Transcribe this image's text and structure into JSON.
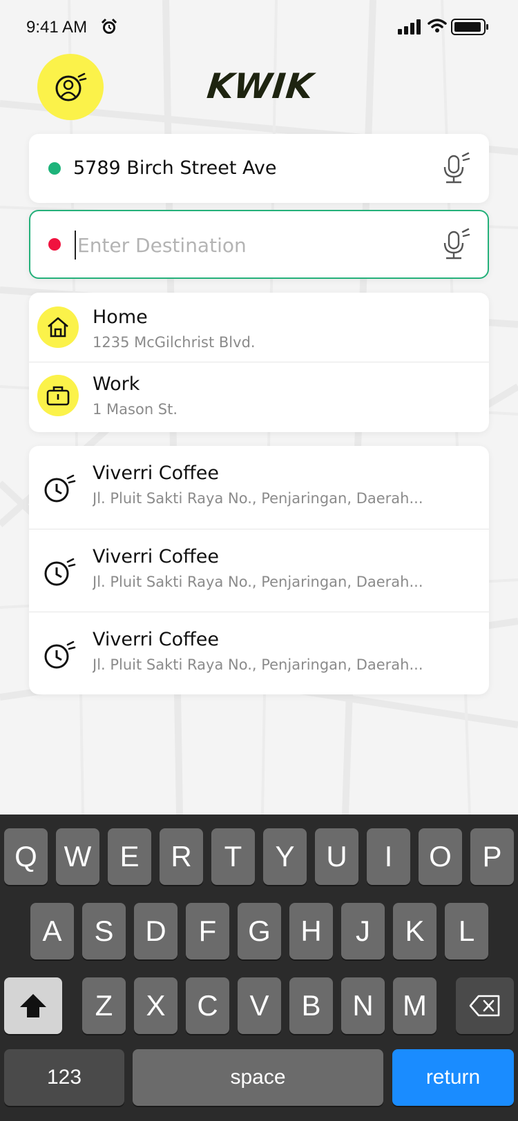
{
  "status_bar": {
    "time": "9:41 AM"
  },
  "brand": {
    "logo_text": "KWIK",
    "accent_color": "#fbf24a",
    "focus_color": "#24b07a"
  },
  "route": {
    "origin": "5789 Birch Street Ave",
    "origin_dot_color": "#1db37a",
    "destination_value": "",
    "destination_placeholder": "Enter Destination",
    "destination_dot_color": "#f0133f"
  },
  "saved_places": [
    {
      "title": "Home",
      "address": "1235 McGilchrist Blvd.",
      "icon": "home-icon"
    },
    {
      "title": "Work",
      "address": "1 Mason St.",
      "icon": "briefcase-icon"
    }
  ],
  "recent_places": [
    {
      "title": "Viverri Coffee",
      "address": "Jl. Pluit Sakti Raya No., Penjaringan, Daerah..."
    },
    {
      "title": "Viverri Coffee",
      "address": "Jl. Pluit Sakti Raya No., Penjaringan, Daerah..."
    },
    {
      "title": "Viverri Coffee",
      "address": "Jl. Pluit Sakti Raya No., Penjaringan, Daerah..."
    }
  ],
  "keyboard": {
    "row1": [
      "Q",
      "W",
      "E",
      "R",
      "T",
      "Y",
      "U",
      "I",
      "O",
      "P"
    ],
    "row2": [
      "A",
      "S",
      "D",
      "F",
      "G",
      "H",
      "J",
      "K",
      "L"
    ],
    "row3": [
      "Z",
      "X",
      "C",
      "V",
      "B",
      "N",
      "M"
    ],
    "numbers_label": "123",
    "space_label": "space",
    "return_label": "return"
  }
}
